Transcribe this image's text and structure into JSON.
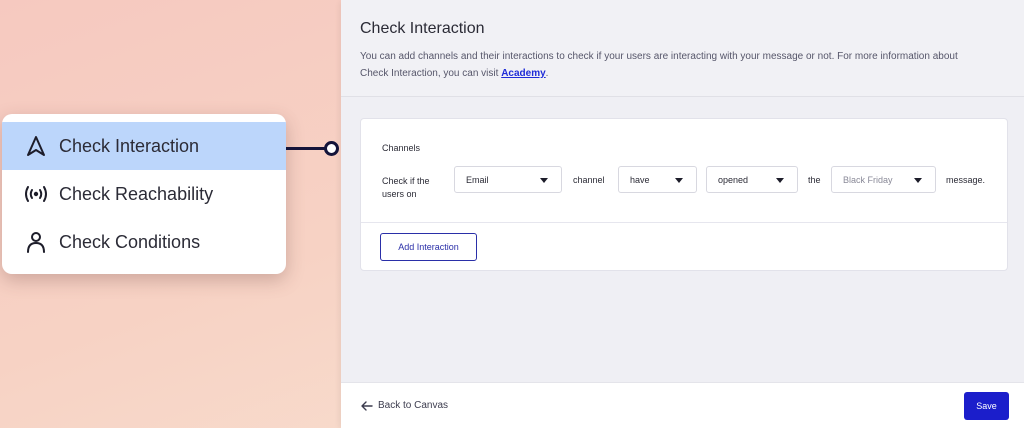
{
  "menu": {
    "items": [
      {
        "label": "Check Interaction",
        "icon": "navigation-arrow-icon",
        "active": true
      },
      {
        "label": "Check Reachability",
        "icon": "broadcast-signal-icon",
        "active": false
      },
      {
        "label": "Check Conditions",
        "icon": "person-icon",
        "active": false
      }
    ]
  },
  "panel": {
    "title": "Check Interaction",
    "description_prefix": "You can add channels and their interactions to check if your users are interacting with your message or not. For more information about Check Interaction, you can visit ",
    "description_link": "Academy",
    "description_suffix": "."
  },
  "channels": {
    "label": "Channels",
    "check_text": "Check if the users on",
    "channel_dropdown": "Email",
    "channel_word": "channel",
    "have_dropdown": "have",
    "action_dropdown": "opened",
    "the_word": "the",
    "message_dropdown": "Black Friday",
    "message_word": "message.",
    "add_button": "Add Interaction"
  },
  "footer": {
    "back_label": "Back to Canvas",
    "save_label": "Save"
  },
  "colors": {
    "active_item": "#bcd6fb",
    "primary": "#1b1ecb",
    "link": "#1f2cd8"
  }
}
